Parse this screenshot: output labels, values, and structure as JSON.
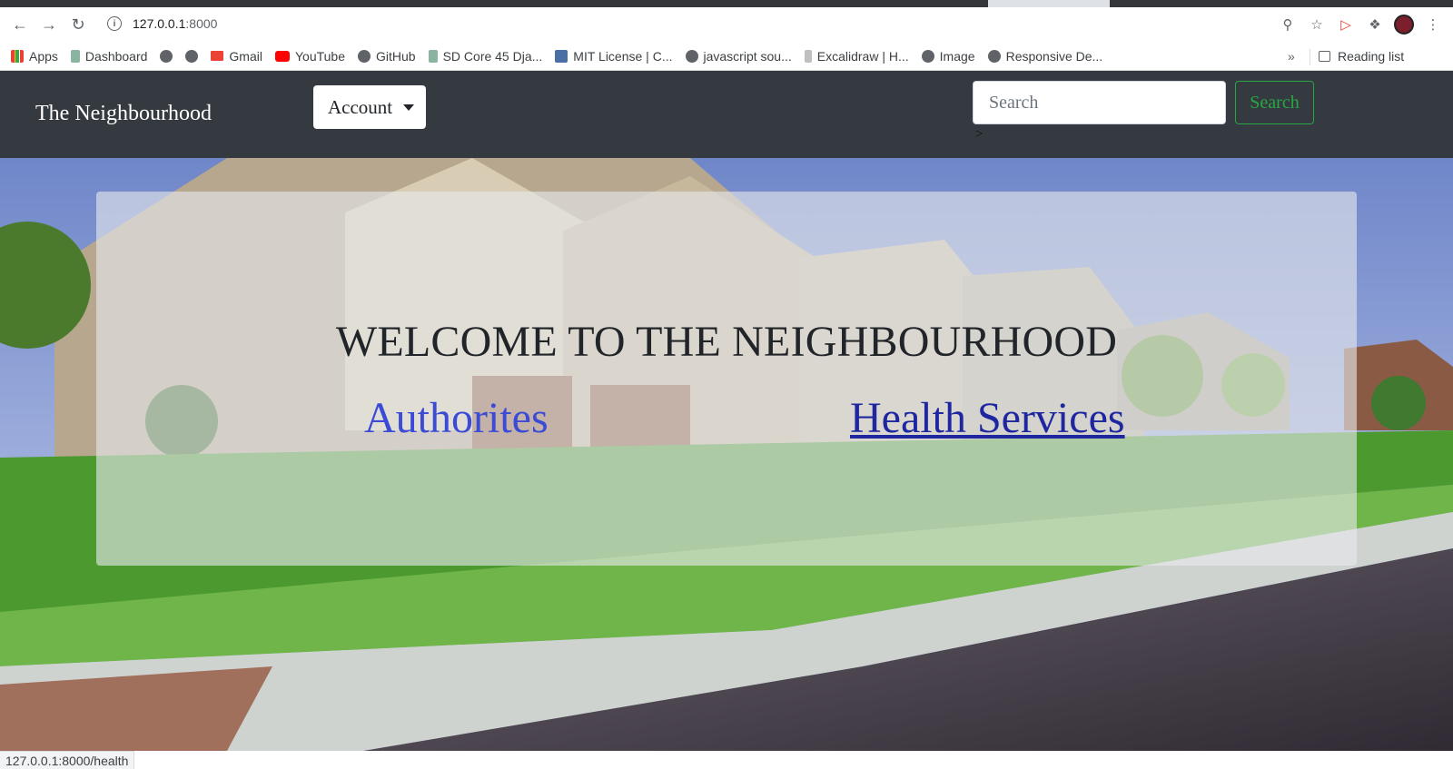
{
  "browser": {
    "url_host": "127.0.0.1",
    "url_port": ":8000",
    "bookmarks": [
      {
        "label": "Apps",
        "icon": "apps-grid-icon"
      },
      {
        "label": "Dashboard",
        "icon": "leaf-icon"
      },
      {
        "label": "",
        "icon": "github-icon"
      },
      {
        "label": "",
        "icon": "globe-icon"
      },
      {
        "label": "Gmail",
        "icon": "gmail-icon"
      },
      {
        "label": "YouTube",
        "icon": "youtube-icon"
      },
      {
        "label": "GitHub",
        "icon": "github-icon"
      },
      {
        "label": "SD Core 45 Dja...",
        "icon": "leaf-icon"
      },
      {
        "label": "MIT License | C...",
        "icon": "mit-icon"
      },
      {
        "label": "javascript sou...",
        "icon": "globe-icon"
      },
      {
        "label": "Excalidraw | H...",
        "icon": "excalidraw-icon"
      },
      {
        "label": "Image",
        "icon": "globe-icon"
      },
      {
        "label": "Responsive De...",
        "icon": "globe-icon"
      }
    ],
    "more_bookmarks": "»",
    "reading_list": "Reading list",
    "status_url": "127.0.0.1:8000/health"
  },
  "navbar": {
    "brand": "The Neighbourhood",
    "account_label": "Account",
    "search_placeholder": "Search",
    "search_button": "Search",
    "stray_text": ">"
  },
  "hero": {
    "headline": "WELCOME TO THE NEIGHBOURHOOD",
    "link_authorities": "Authorites",
    "link_health": "Health Services"
  }
}
